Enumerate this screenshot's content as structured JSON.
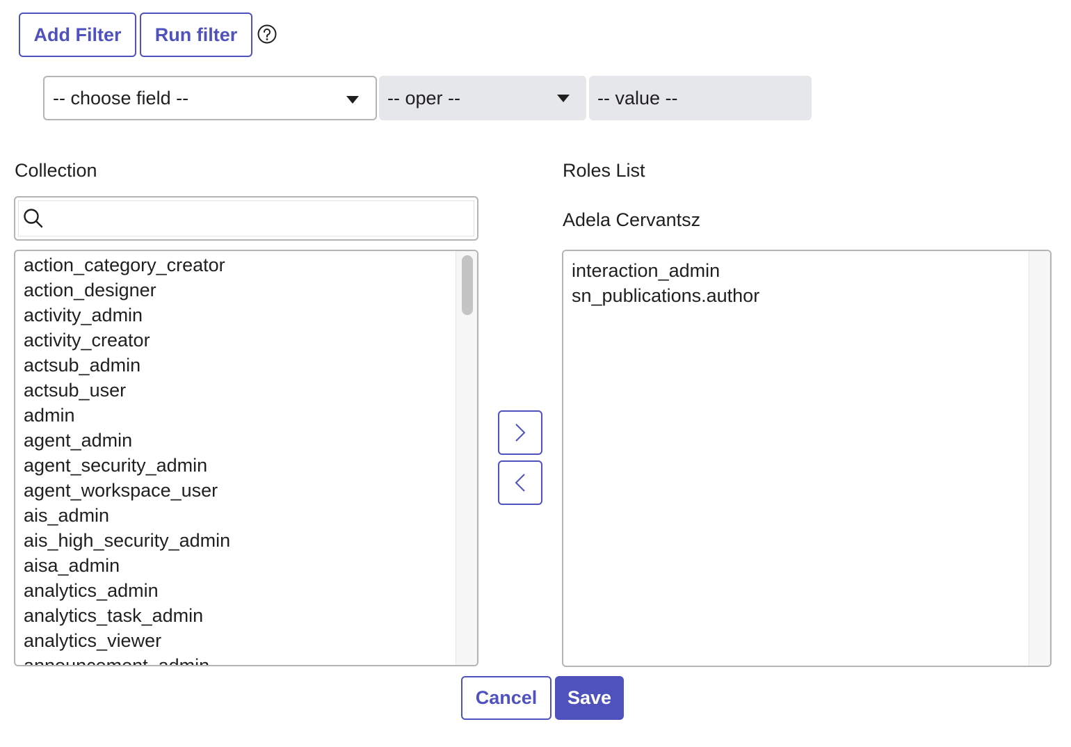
{
  "toolbar": {
    "add_filter_label": "Add Filter",
    "run_filter_label": "Run filter",
    "help_icon": "question-circle-icon"
  },
  "filter": {
    "field_placeholder": "-- choose field --",
    "oper_placeholder": "-- oper --",
    "value_placeholder": "-- value --"
  },
  "collection": {
    "heading": "Collection",
    "search_value": "",
    "items": [
      "action_category_creator",
      "action_designer",
      "activity_admin",
      "activity_creator",
      "actsub_admin",
      "actsub_user",
      "admin",
      "agent_admin",
      "agent_security_admin",
      "agent_workspace_user",
      "ais_admin",
      "ais_high_security_admin",
      "aisa_admin",
      "analytics_admin",
      "analytics_task_admin",
      "analytics_viewer",
      "announcement_admin"
    ]
  },
  "roles": {
    "heading": "Roles List",
    "user_name": "Adela Cervantsz",
    "items": [
      "interaction_admin",
      "sn_publications.author"
    ]
  },
  "actions": {
    "add_icon": "chevron-right-icon",
    "remove_icon": "chevron-left-icon",
    "cancel_label": "Cancel",
    "save_label": "Save"
  },
  "colors": {
    "accent": "#4f52bd",
    "border": "#b4b4b4",
    "disabled_bg": "#e6e7ea"
  }
}
